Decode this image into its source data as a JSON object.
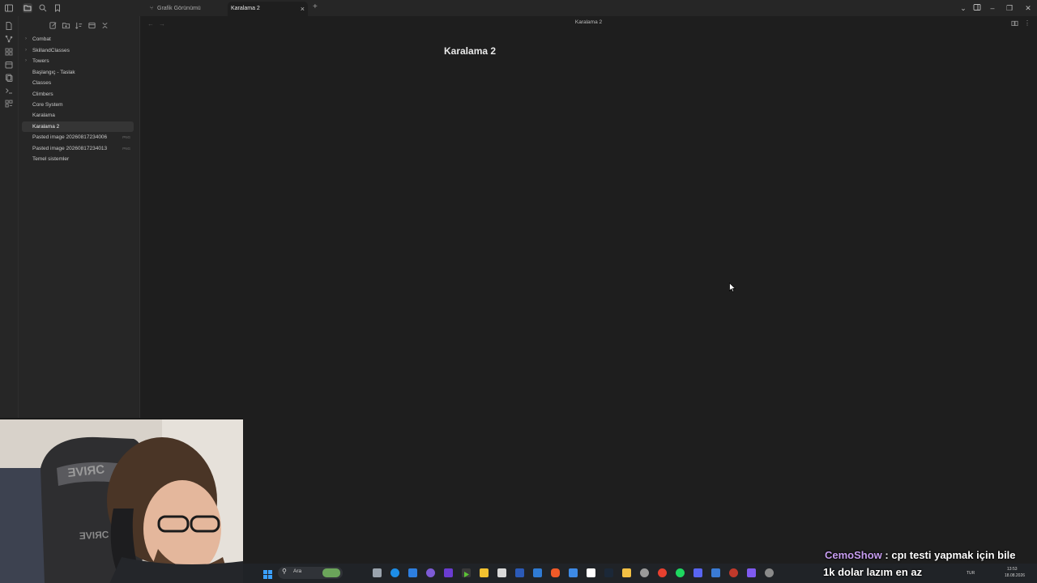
{
  "tabs": [
    {
      "label": "Grafik Görünümü",
      "active": false
    },
    {
      "label": "Karalama 2",
      "active": true
    }
  ],
  "new_tab_symbol": "+",
  "close_tab_symbol": "×",
  "file_tree": [
    {
      "label": "Combat",
      "type": "folder",
      "ext": ""
    },
    {
      "label": "SkillandClasses",
      "type": "folder",
      "ext": ""
    },
    {
      "label": "Towers",
      "type": "folder",
      "ext": ""
    },
    {
      "label": "Başlangıç - Taslak",
      "type": "file",
      "ext": ""
    },
    {
      "label": "Classes",
      "type": "file",
      "ext": ""
    },
    {
      "label": "Climbers",
      "type": "file",
      "ext": ""
    },
    {
      "label": "Core System",
      "type": "file",
      "ext": ""
    },
    {
      "label": "Karalama",
      "type": "file",
      "ext": ""
    },
    {
      "label": "Karalama 2",
      "type": "file",
      "ext": "",
      "active": true
    },
    {
      "label": "Pasted image 20260817234006",
      "type": "file",
      "ext": "PNG"
    },
    {
      "label": "Pasted image 20260817234013",
      "type": "file",
      "ext": "PNG"
    },
    {
      "label": "Temel sistemler",
      "type": "file",
      "ext": ""
    }
  ],
  "editor": {
    "view_title": "Karalama 2",
    "note_title": "Karalama 2"
  },
  "taskbar": {
    "search_placeholder": "Ara",
    "language": "TUR",
    "time": "13:53",
    "date": "18.08.2026"
  },
  "chat": {
    "username": "CemoShow",
    "separator": " : ",
    "message_line1": "cpı testi yapmak için bile",
    "message_line2": "1k dolar lazım en az"
  },
  "colors": {
    "background": "#1e1e1e",
    "sidebar": "#262626",
    "chat_username": "#c79df0"
  }
}
